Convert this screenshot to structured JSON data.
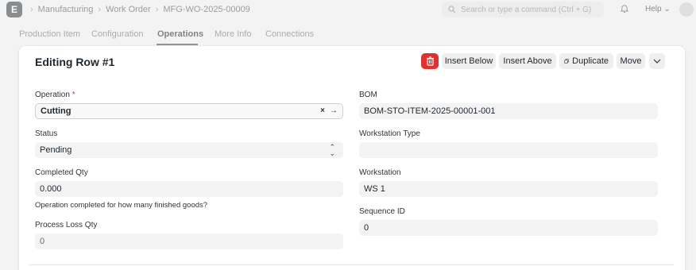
{
  "topbar": {
    "logo_letter": "E",
    "breadcrumbs": [
      "Manufacturing",
      "Work Order",
      "MFG-WO-2025-00009"
    ],
    "separator": "›",
    "search_placeholder": "Search or type a command (Ctrl + G)",
    "help_label": "Help"
  },
  "tabs": [
    "Production Item",
    "Configuration",
    "Operations",
    "More Info",
    "Connections"
  ],
  "active_tab": "Operations",
  "editor": {
    "title": "Editing Row #1",
    "buttons": {
      "insert_below": "Insert Below",
      "insert_above": "Insert Above",
      "duplicate": "Duplicate",
      "move": "Move"
    },
    "left": {
      "operation": {
        "label": "Operation",
        "required_mark": "*",
        "value": "Cutting",
        "clear_icon": "×",
        "open_icon": "→"
      },
      "status": {
        "label": "Status",
        "value": "Pending"
      },
      "completed_qty": {
        "label": "Completed Qty",
        "value": "0.000",
        "help": "Operation completed for how many finished goods?"
      },
      "process_loss_qty": {
        "label": "Process Loss Qty",
        "value": "0"
      }
    },
    "right": {
      "bom": {
        "label": "BOM",
        "value": "BOM-STO-ITEM-2025-00001-001"
      },
      "workstation_type": {
        "label": "Workstation Type",
        "value": ""
      },
      "workstation": {
        "label": "Workstation",
        "value": "WS 1"
      },
      "sequence_id": {
        "label": "Sequence ID",
        "value": "0"
      }
    }
  },
  "colors": {
    "delete": "#e03131",
    "field_bg": "#f3f3f3",
    "page_bg": "#f3f3f3"
  }
}
